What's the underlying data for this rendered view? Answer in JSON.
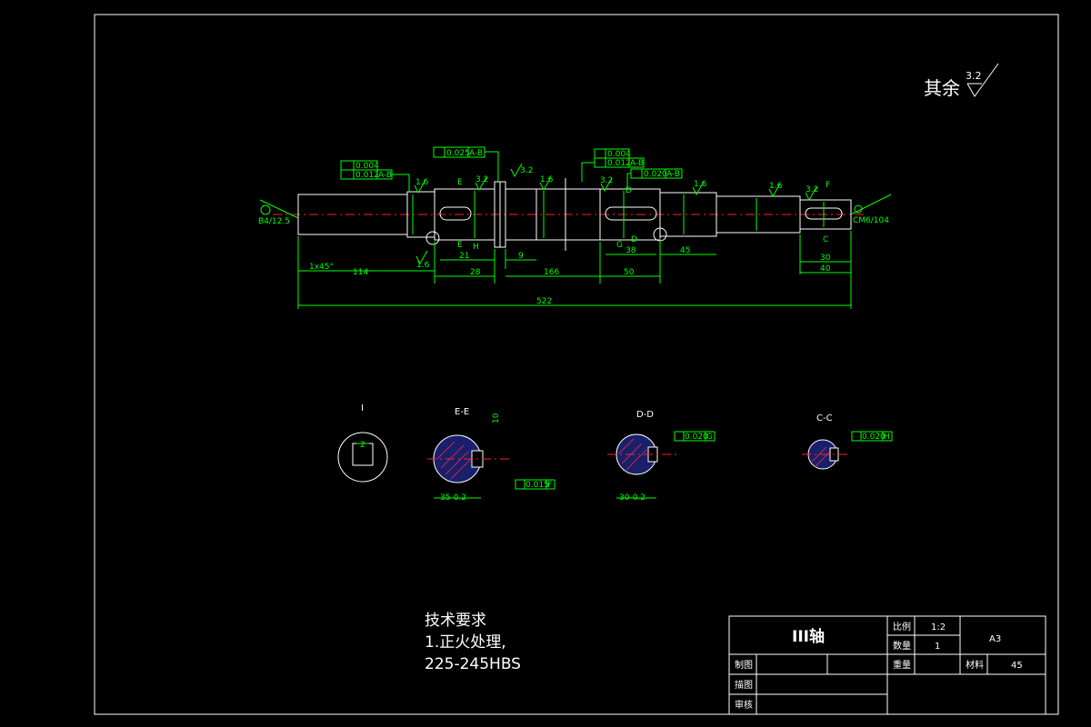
{
  "surface_note": {
    "text": "其余",
    "value": "3.2"
  },
  "dimensions": {
    "overall": "522",
    "d1": "114",
    "d2": "28",
    "d3": "21",
    "d4": "9",
    "d5": "166",
    "d6": "50",
    "d7": "38",
    "d8": "45",
    "d9": "30",
    "d10": "40",
    "chamfer": "1x45°"
  },
  "tolerance_frames": {
    "t1a": "0.004",
    "t1b": "0.012",
    "t1b_ref": "A-B",
    "t2": "0.025",
    "t2_ref": "A-B",
    "t3a": "0.004",
    "t3b": "0.012",
    "t3b_ref": "A-B",
    "t4": "0.020",
    "t4_ref": "A-B",
    "sec_ee": "0.015",
    "sec_ee_ref": "F",
    "sec_dd": "0.020",
    "sec_dd_ref": "G",
    "sec_cc": "0.020",
    "sec_cc_ref": "H"
  },
  "roughness": {
    "r1": "1.6",
    "r2": "3.2",
    "r3": "1.6",
    "r4": "3.2",
    "r5": "1.6",
    "r6": "1.6",
    "r7": "3.2",
    "r8": "1.6",
    "r9": "3.2"
  },
  "center_holes": {
    "left": "B4/12.5",
    "right": "CM6/104"
  },
  "section_labels": {
    "detail": "I",
    "ee": "E-E",
    "dd": "D-D",
    "cc": "C-C",
    "ee_width": "35-0.2",
    "dd_width": "30-0.2",
    "ee_key": "10",
    "detail_dim": "2"
  },
  "cut_markers": {
    "e": "E",
    "d": "D",
    "c": "C",
    "f": "F",
    "g": "G",
    "h": "H"
  },
  "tech_req": {
    "title": "技术要求",
    "line1": "1.正火处理,",
    "line2": "225-245HBS"
  },
  "title_block": {
    "part_name": "III轴",
    "scale_label": "比例",
    "scale_value": "1:2",
    "qty_label": "数量",
    "qty_value": "1",
    "weight_label": "重量",
    "material_label": "材料",
    "material_value": "45",
    "sheet_size": "A3",
    "drawn_label": "制图",
    "drafted_label": "描图",
    "review_label": "审核"
  }
}
